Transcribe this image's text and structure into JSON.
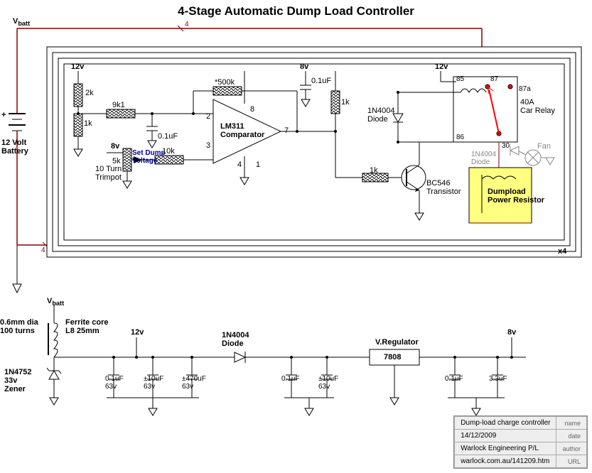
{
  "title": "4-Stage Automatic Dump Load Controller",
  "battery": {
    "vlabel": "V",
    "vsub": "batt",
    "name": "12 Volt\nBattery",
    "plus": "+"
  },
  "stage": {
    "r_2k": "2k",
    "r_9k1": "9k1",
    "r_1k_a": "1k",
    "r_10k": "10k",
    "r_500k": "*500k",
    "r_1k_b": "1k",
    "r_1k_c": "1k",
    "c_01_a": "0.1uF",
    "c_01_b": "0.1uF",
    "trimpot": "10 Turn\nTrimpot",
    "trimpot_val": "5k",
    "set_dump": "Set Dump\nVoltage",
    "comp": "LM311\nComparator",
    "pin2": "2",
    "pin3": "3",
    "pin4": "4",
    "pin1": "1",
    "pin8": "8",
    "pin7": "7",
    "v12": "12v",
    "v8": "8v",
    "v12b": "12v",
    "tran": "BC546\nTransistor",
    "diode_a": "1N4004\nDiode",
    "diode_b": "1N4004\nDiode",
    "relay": "40A\nCar Relay",
    "r85": "85",
    "r86": "86",
    "r87": "87",
    "r87a": "87a",
    "r30": "30",
    "fan": "Fan",
    "dump": "Dumpload\nPower Resistor",
    "x4": "x4",
    "tick1": "4",
    "tick2": "4"
  },
  "psu": {
    "vbatt": "V",
    "vsub": "batt",
    "ind": "Ferrite core\nL8 25mm",
    "wire": "0.6mm dia\n100 turns",
    "zener": "1N4752\n33v\nZener",
    "c1": "0.1uF\n63v",
    "c2": "±10uF\n63v",
    "c3": "±470uF\n63v",
    "c4": "0.1uF",
    "c5": "±10uF\n63v",
    "c6": "0.1uF",
    "c7": "3.3uF",
    "diode": "1N4004\nDiode",
    "reg": "7808",
    "reg_lbl": "V.Regulator",
    "v12": "12v",
    "v8": "8v"
  },
  "info": {
    "name": "Dump-load charge controller",
    "name_l": "name",
    "date": "14/12/2009",
    "date_l": "date",
    "author": "Warlock Engineering P/L",
    "author_l": "author",
    "url": "warlock.com.au/141209.htm",
    "url_l": "URL"
  }
}
